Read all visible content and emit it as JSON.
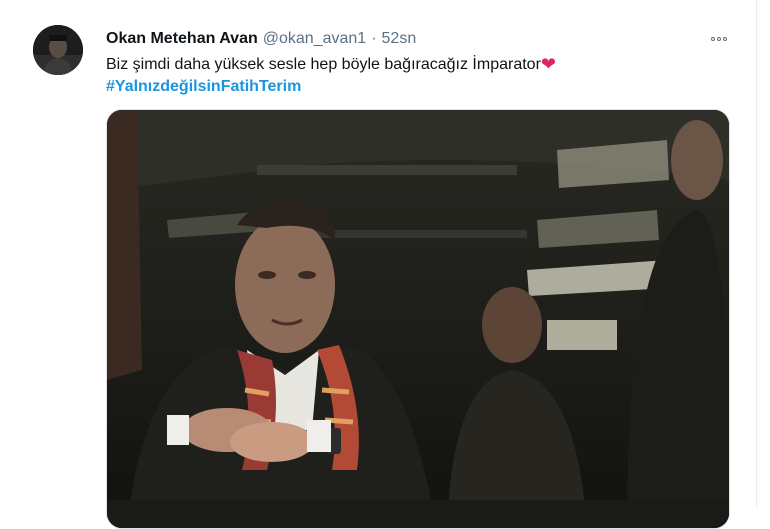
{
  "tweet": {
    "display_name": "Okan Metehan Avan",
    "handle": "@okan_avan1",
    "separator": "·",
    "timestamp": "52sn",
    "text": "Biz şimdi daha yüksek sesle hep böyle bağıracağız İmparator",
    "heart": "❤",
    "hashtag": "#YalnızdeğilsinFatihTerim"
  },
  "icons": {
    "more": "more-options-icon",
    "heart": "red-heart-emoji"
  },
  "colors": {
    "name": "#0f1419",
    "meta": "#5b7083",
    "hashtag": "#1b95e0",
    "heart": "#e0245e"
  }
}
